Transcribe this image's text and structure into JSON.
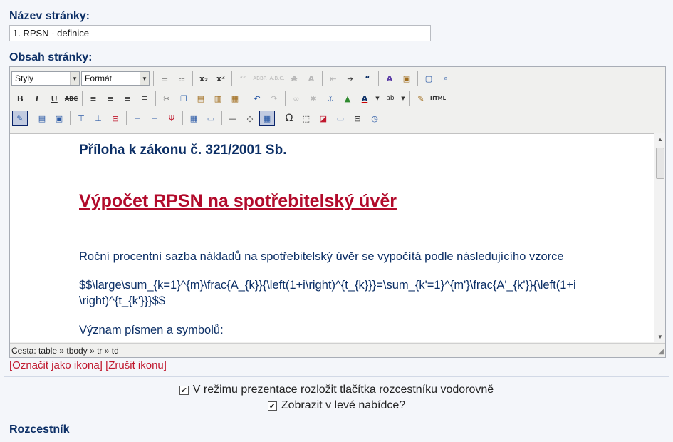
{
  "page_name_label": "Název stránky:",
  "page_name_value": "1. RPSN - definice",
  "page_content_label": "Obsah stránky:",
  "toolbar": {
    "styles_select": "Styly",
    "format_select": "Formát",
    "row1": [
      "bullet-list",
      "numbered-list",
      "subscript",
      "superscript",
      "quote-a",
      "abbr",
      "acronym",
      "strikeout-a",
      "color-a",
      "outdent",
      "indent",
      "blockquote",
      "spellcheck",
      "insert-template",
      "preview",
      "search"
    ],
    "html_label": "HTML",
    "omega": "Ω"
  },
  "content": {
    "heading_annex": "Příloha k zákonu č. 321/2001 Sb.",
    "heading_title": "Výpočet RPSN na spotřebitelský úvěr",
    "paragraph_intro": "Roční procentní sazba nákladů na spotřebitelský úvěr se vypočítá podle následujícího vzorce",
    "formula_line1": "$$\\large\\sum_{k=1}^{m}\\frac{A_{k}}{\\left(1+i\\right)^{t_{k}}}=\\sum_{k'=1}^{m'}\\frac{A'_{k'}}{\\left(1+i",
    "formula_line2": "\\right)^{t_{k'}}}$$",
    "paragraph_meaning": "Význam písmen a symbolů:"
  },
  "status_path": "Cesta: table » tbody » tr » td",
  "link_mark_icon": "[Označit jako ikona]",
  "link_cancel_icon": "[Zrušit ikonu]",
  "checkbox_horizontal_label": "V režimu prezentace rozložit tlačítka rozcestníku vodorovně",
  "checkbox_left_menu_label": "Zobrazit v levé nabídce?",
  "section_rozcestnik": "Rozcestník",
  "colors": {
    "label_blue": "#0c2f66",
    "title_red": "#b20a2b",
    "link_red": "#c0172d"
  }
}
